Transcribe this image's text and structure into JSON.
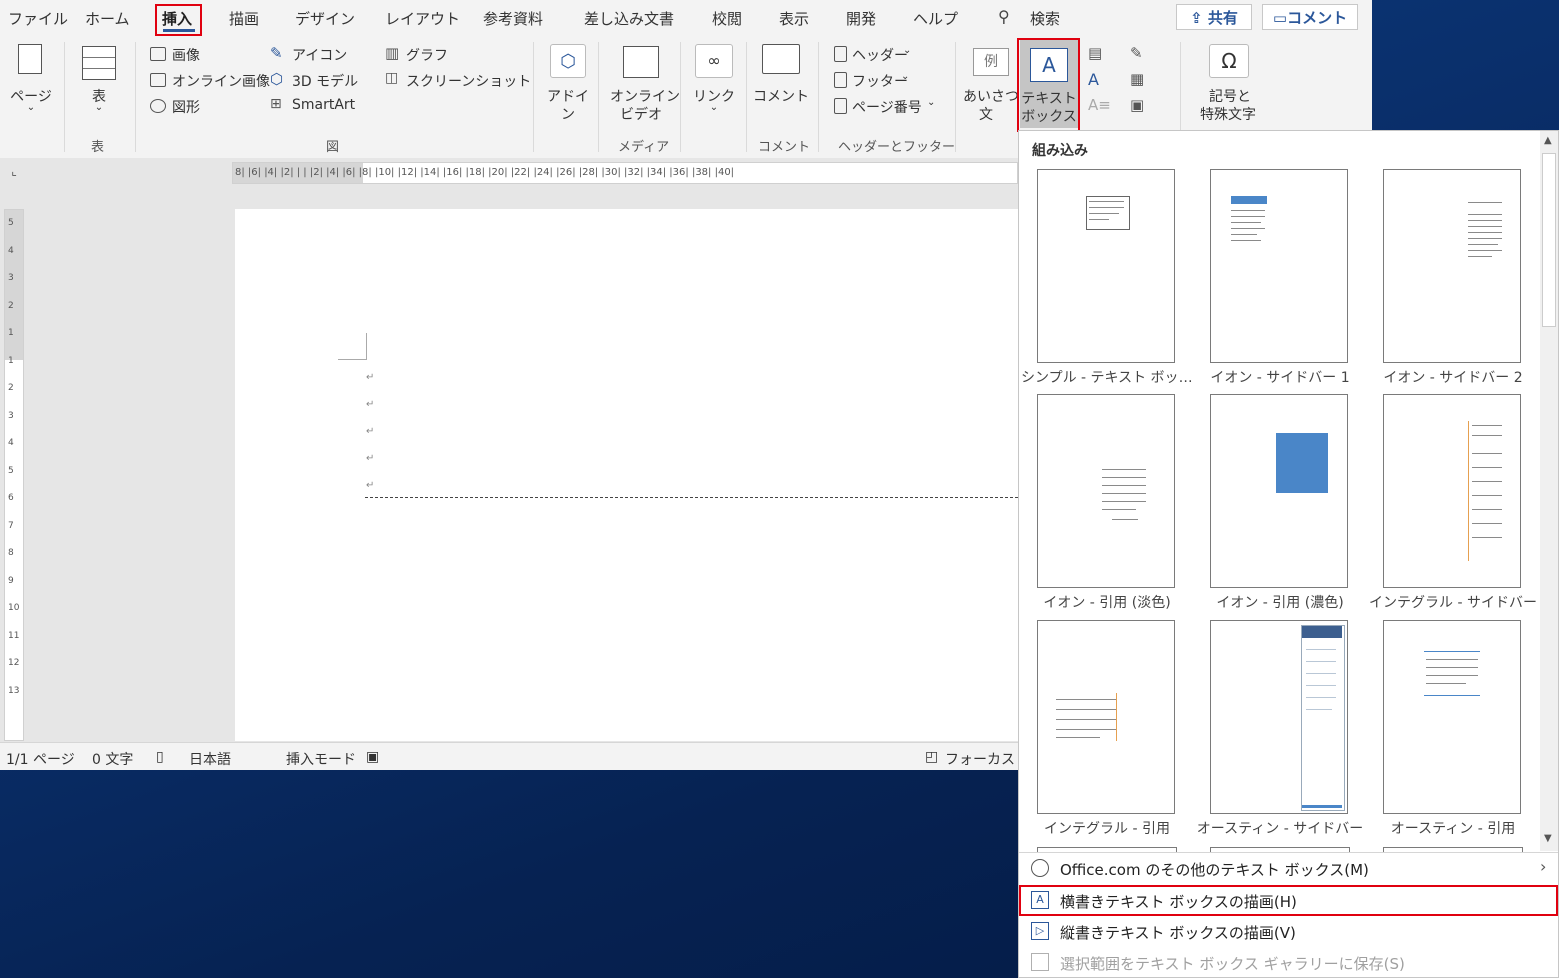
{
  "menubar": {
    "tabs": [
      "ファイル",
      "ホーム",
      "挿入",
      "描画",
      "デザイン",
      "レイアウト",
      "参考資料",
      "差し込み文書",
      "校閲",
      "表示",
      "開発",
      "ヘルプ"
    ],
    "search_label": "検索",
    "share_label": "共有",
    "comment_label": "コメント"
  },
  "ribbon": {
    "pages": "ページ",
    "table": "表",
    "table_group": "表",
    "image": "画像",
    "online_image": "オンライン画像",
    "shapes": "図形",
    "icons": "アイコン",
    "models3d": "3D モデル",
    "smartart": "SmartArt",
    "chart": "グラフ",
    "screenshot": "スクリーンショット",
    "illust_group": "図",
    "addins_1": "アドイ",
    "addins_2": "ン",
    "online_video_1": "オンライン",
    "online_video_2": "ビデオ",
    "media_group": "メディア",
    "link": "リンク",
    "comment": "コメント",
    "comment_group": "コメント",
    "header": "ヘッダー",
    "footer": "フッター",
    "page_number": "ページ番号",
    "hf_group": "ヘッダーとフッター",
    "greeting_1": "あいさつ",
    "greeting_2": "文",
    "greeting_icon": "例",
    "textbox_1": "テキスト",
    "textbox_2": "ボックス",
    "symbol_1": "記号と",
    "symbol_2": "特殊文字"
  },
  "ruler": {
    "h_ticks": "8| |6| |4| |2| | |  |2| |4| |6| |8| |10| |12| |14| |16| |18| |20| |22| |24| |26| |28| |30| |32| |34| |36| |38| |40|",
    "v_ticks": [
      "5",
      "4",
      "3",
      "2",
      "1",
      "1",
      "2",
      "3",
      "4",
      "5",
      "6",
      "7",
      "8",
      "9",
      "10",
      "11",
      "12",
      "13"
    ]
  },
  "status": {
    "page": "1/1 ページ",
    "words": "0 文字",
    "language": "日本語",
    "mode": "挿入モード",
    "focus": "フォーカス"
  },
  "gallery": {
    "heading": "組み込み",
    "items": [
      "シンプル - テキスト ボックス",
      "イオン - サイドバー 1",
      "イオン - サイドバー 2",
      "イオン - 引用 (淡色)",
      "イオン - 引用 (濃色)",
      "インテグラル - サイドバー",
      "インテグラル - 引用",
      "オースティン - サイドバー",
      "オースティン - 引用"
    ],
    "menu_more": "Office.com のその他のテキスト ボックス(M)",
    "menu_horizontal": "横書きテキスト ボックスの描画(H)",
    "menu_vertical": "縦書きテキスト ボックスの描画(V)",
    "menu_save": "選択範囲をテキスト ボックス ギャラリーに保存(S)"
  },
  "colors": {
    "accent": "#2b579a",
    "highlight": "#e0000f",
    "desktop": "#0a2f6b"
  }
}
